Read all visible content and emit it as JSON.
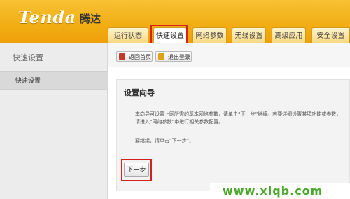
{
  "header": {
    "logo": "Tenda",
    "logo_cn": "腾达"
  },
  "nav": {
    "tabs": [
      {
        "label": "运行状态"
      },
      {
        "label": "快速设置",
        "active": true
      },
      {
        "label": "网络参数"
      },
      {
        "label": "无线设置"
      },
      {
        "label": "高级应用"
      },
      {
        "label": "安全设置"
      }
    ]
  },
  "sidebar": {
    "title": "快速设置",
    "items": [
      {
        "label": "快速设置"
      }
    ]
  },
  "toolbar": {
    "home_label": "返回首页",
    "logout_label": "退出登录",
    "home_icon": "home-icon",
    "logout_icon": "logout-icon"
  },
  "panel": {
    "title": "设置向导",
    "description": "本向导可设置上网所需的基本网络参数，请单击“下一步”继续。若要详细设置某项功能或参数，请进入“网络参数”中进行相关参数配置。",
    "continue_text": "要继续，请单击“下一步”。",
    "next_label": "下一步"
  },
  "watermark": "www.xiqb.com",
  "colors": {
    "header": "#f2ad12",
    "highlight": "#d61f1f",
    "watermark": "#4aa82b"
  }
}
